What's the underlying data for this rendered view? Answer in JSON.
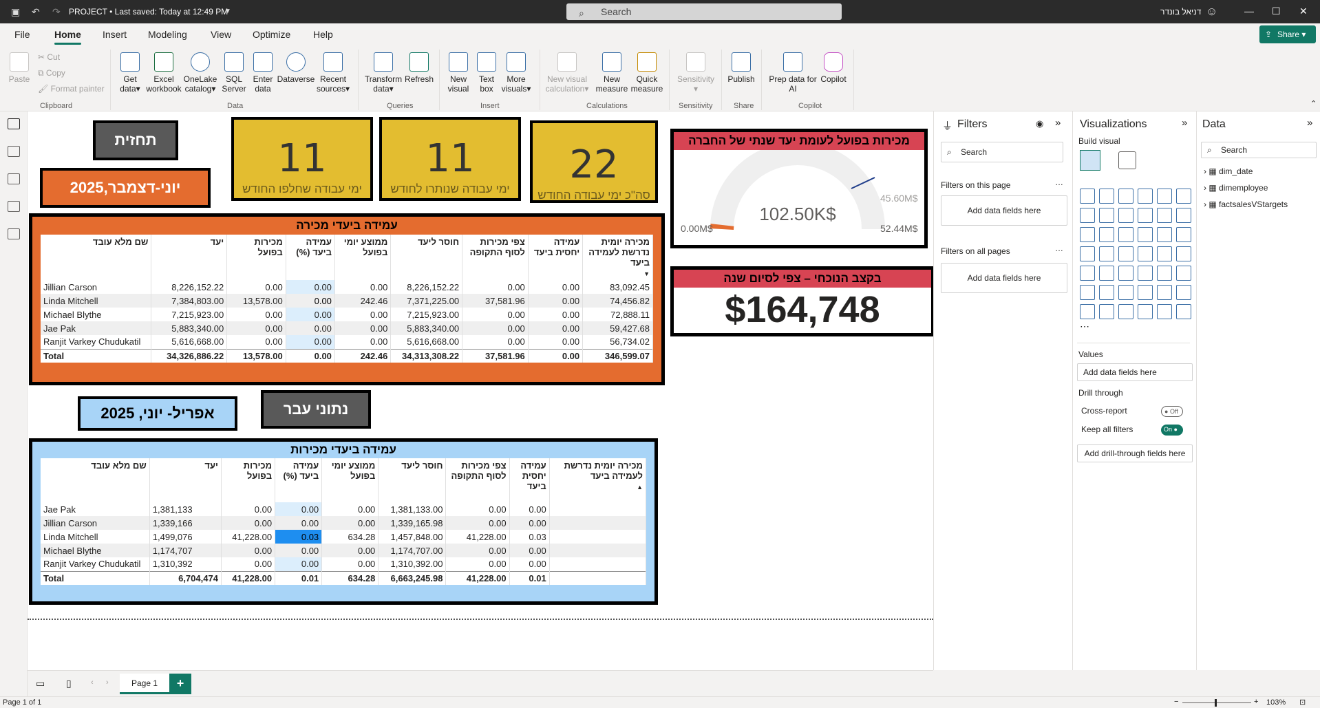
{
  "titlebar": {
    "title": "PROJECT • Last saved: Today at 12:49 PM",
    "search_placeholder": "Search",
    "user": "דניאל בונדר"
  },
  "menu": {
    "file": "File",
    "home": "Home",
    "insert": "Insert",
    "modeling": "Modeling",
    "view": "View",
    "optimize": "Optimize",
    "help": "Help",
    "share": "Share"
  },
  "ribbon": {
    "paste": "Paste",
    "cut": "Cut",
    "copy": "Copy",
    "format_painter": "Format painter",
    "clipboard": "Clipboard",
    "get_data_1": "Get",
    "get_data_2": "data",
    "excel_1": "Excel",
    "excel_2": "workbook",
    "onelake_1": "OneLake",
    "onelake_2": "catalog",
    "sql_1": "SQL",
    "sql_2": "Server",
    "enter_1": "Enter",
    "enter_2": "data",
    "dataverse": "Dataverse",
    "recent_1": "Recent",
    "recent_2": "sources",
    "data_group": "Data",
    "transform_1": "Transform",
    "transform_2": "data",
    "refresh": "Refresh",
    "queries_group": "Queries",
    "newvis_1": "New",
    "newvis_2": "visual",
    "textbox_1": "Text",
    "textbox_2": "box",
    "morevis_1": "More",
    "morevis_2": "visuals",
    "insert_group": "Insert",
    "newcalc_1": "New visual",
    "newcalc_2": "calculation",
    "newmeas_1": "New",
    "newmeas_2": "measure",
    "quick_1": "Quick",
    "quick_2": "measure",
    "calc_group": "Calculations",
    "sensitivity": "Sensitivity",
    "sensitivity_group": "Sensitivity",
    "publish": "Publish",
    "share_group": "Share",
    "prep_1": "Prep data for",
    "prep_2": "AI",
    "copilot": "Copilot",
    "copilot_group": "Copilot"
  },
  "canvas": {
    "btn_forecast": "תחזית",
    "btn_period_current": "יוני-דצמבר,2025",
    "btn_past": "נתוני עבר",
    "btn_period_past": "אפריל- יוני, 2025",
    "kpis": [
      {
        "value": "11",
        "label": "ימי עבודה שחלפו החודש"
      },
      {
        "value": "11",
        "label": "ימי עבודה שנותרו לחודש"
      },
      {
        "value": "22",
        "label": "סה\"כ ימי עבודה החודש"
      }
    ],
    "gauge": {
      "title": "מכירות בפועל לעומת יעד שנתי של החברה",
      "value": "102.50K$",
      "min": "0.00M$",
      "max": "52.44M$",
      "target": "45.60M$"
    },
    "card": {
      "title": "בקצב הנוכחי – צפי לסיום שנה",
      "value": "$164,748"
    },
    "table1": {
      "title": "עמידה ביעדי מכירה",
      "headers": [
        "שם מלא עובד",
        "יעד",
        "מכירות בפועל",
        "עמידה ביעד (%)",
        "ממוצע יומי בפועל",
        "חוסר ליעד",
        "צפי מכירות לסוף התקופה",
        "עמידה יחסית ביעד",
        "מכירה יומית נדרשת לעמידה ביעד"
      ],
      "rows": [
        [
          "Jillian Carson",
          "8,226,152.22",
          "0.00",
          "0.00",
          "0.00",
          "8,226,152.22",
          "0.00",
          "0.00",
          "83,092.45"
        ],
        [
          "Linda Mitchell",
          "7,384,803.00",
          "13,578.00",
          "0.00",
          "242.46",
          "7,371,225.00",
          "37,581.96",
          "0.00",
          "74,456.82"
        ],
        [
          "Michael Blythe",
          "7,215,923.00",
          "0.00",
          "0.00",
          "0.00",
          "7,215,923.00",
          "0.00",
          "0.00",
          "72,888.11"
        ],
        [
          "Jae Pak",
          "5,883,340.00",
          "0.00",
          "0.00",
          "0.00",
          "5,883,340.00",
          "0.00",
          "0.00",
          "59,427.68"
        ],
        [
          "Ranjit Varkey Chudukatil",
          "5,616,668.00",
          "0.00",
          "0.00",
          "0.00",
          "5,616,668.00",
          "0.00",
          "0.00",
          "56,734.02"
        ]
      ],
      "total": [
        "Total",
        "34,326,886.22",
        "13,578.00",
        "0.00",
        "242.46",
        "34,313,308.22",
        "37,581.96",
        "0.00",
        "346,599.07"
      ]
    },
    "table2": {
      "title": "עמידה ביעדי מכירות",
      "headers": [
        "שם מלא עובד",
        "יעד",
        "מכירות בפועל",
        "עמידה ביעד (%)",
        "ממוצע יומי בפועל",
        "חוסר ליעד",
        "צפי מכירות לסוף התקופה",
        "עמידה יחסית ביעד",
        "מכירה יומית נדרשת לעמידה ביעד"
      ],
      "rows": [
        [
          "Jae Pak",
          "1,381,133",
          "0.00",
          "0.00",
          "0.00",
          "1,381,133.00",
          "0.00",
          "0.00",
          ""
        ],
        [
          "Jillian Carson",
          "1,339,166",
          "0.00",
          "0.00",
          "0.00",
          "1,339,165.98",
          "0.00",
          "0.00",
          ""
        ],
        [
          "Linda Mitchell",
          "1,499,076",
          "41,228.00",
          "0.03",
          "634.28",
          "1,457,848.00",
          "41,228.00",
          "0.03",
          ""
        ],
        [
          "Michael Blythe",
          "1,174,707",
          "0.00",
          "0.00",
          "0.00",
          "1,174,707.00",
          "0.00",
          "0.00",
          ""
        ],
        [
          "Ranjit Varkey Chudukatil",
          "1,310,392",
          "0.00",
          "0.00",
          "0.00",
          "1,310,392.00",
          "0.00",
          "0.00",
          ""
        ]
      ],
      "total": [
        "Total",
        "6,704,474",
        "41,228.00",
        "0.01",
        "634.28",
        "6,663,245.98",
        "41,228.00",
        "0.01",
        ""
      ]
    }
  },
  "filters": {
    "title": "Filters",
    "search": "Search",
    "on_page": "Filters on this page",
    "on_all": "Filters on all pages",
    "add1": "Add data fields here",
    "add2": "Add data fields here"
  },
  "viz": {
    "title": "Visualizations",
    "build": "Build visual",
    "values": "Values",
    "add_values": "Add data fields here",
    "drill": "Drill through",
    "cross": "Cross-report",
    "cross_state": "Off",
    "keep": "Keep all filters",
    "keep_state": "On",
    "add_drill": "Add drill-through fields here"
  },
  "datapane": {
    "title": "Data",
    "search": "Search",
    "tables": [
      "dim_date",
      "dimemployee",
      "factsalesVStargets"
    ]
  },
  "pagebar": {
    "page1": "Page 1"
  },
  "status": {
    "page": "Page 1 of 1",
    "zoom": "103%"
  }
}
